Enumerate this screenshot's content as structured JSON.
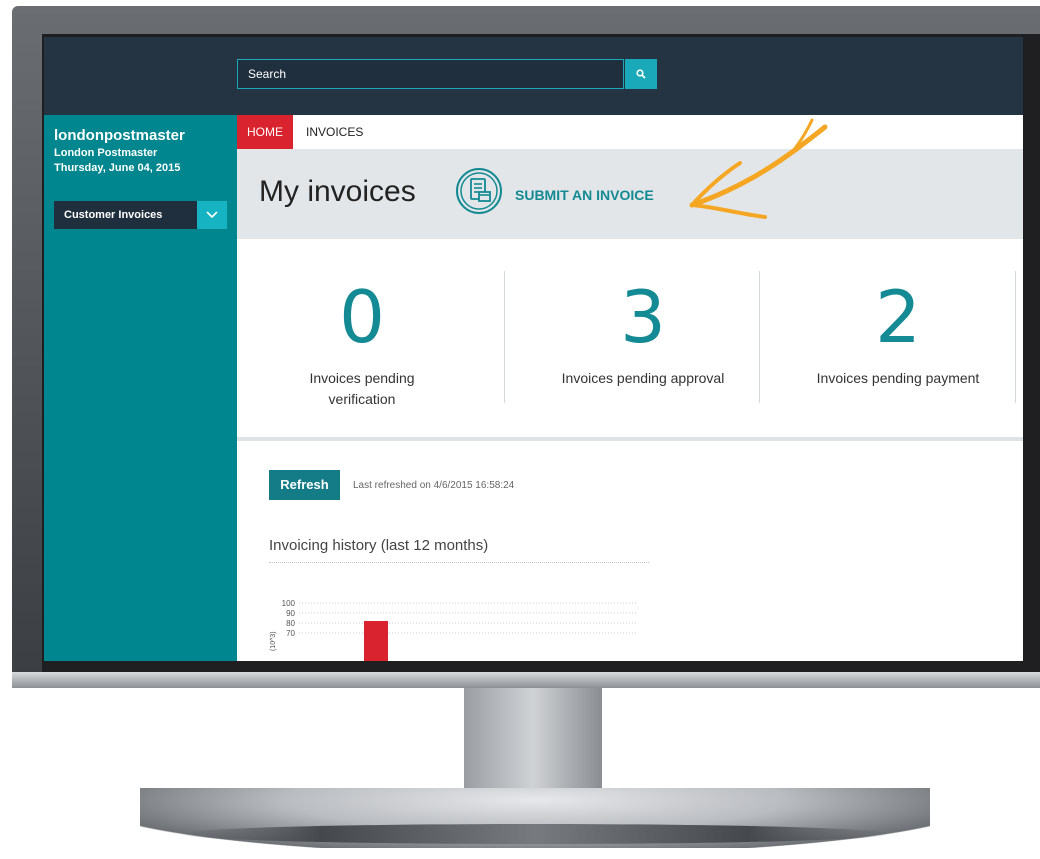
{
  "search": {
    "placeholder": "Search"
  },
  "user": {
    "username": "londonpostmaster",
    "full_name": "London Postmaster",
    "date": "Thursday, June 04, 2015"
  },
  "nav": {
    "dropdown_label": "Customer Invoices"
  },
  "breadcrumb": {
    "home": "HOME",
    "current": "INVOICES"
  },
  "page": {
    "title": "My invoices",
    "submit_label": "SUBMIT AN INVOICE"
  },
  "stats": [
    {
      "value": "0",
      "label": "Invoices pending verification"
    },
    {
      "value": "3",
      "label": "Invoices pending approval"
    },
    {
      "value": "2",
      "label": "Invoices pending payment"
    }
  ],
  "refresh": {
    "button_label": "Refresh",
    "last_refreshed": "Last refreshed on 4/6/2015 16:58:24"
  },
  "history": {
    "title": "Invoicing history (last 12 months)"
  },
  "chart_data": {
    "type": "bar",
    "ylabel": "(10^3)",
    "yticks": [
      100,
      90,
      80,
      70
    ],
    "ylim": [
      70,
      100
    ],
    "series": [
      {
        "values": [
          82
        ],
        "color": "#d9232e"
      }
    ],
    "grid": true
  },
  "colors": {
    "teal": "#00868f",
    "navy": "#243442",
    "red": "#d9232e",
    "accent": "#f5a623"
  }
}
